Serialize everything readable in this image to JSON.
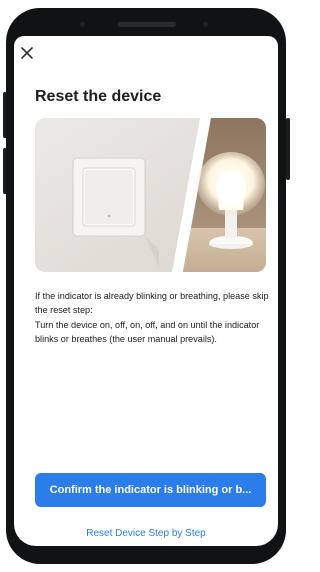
{
  "header": {
    "close_icon": "close-icon",
    "title": "Reset the device"
  },
  "hero": {
    "illustration": "switch-and-bulb-illustration"
  },
  "instructions": {
    "line1": "If the indicator is already blinking or breathing, please skip the reset step:",
    "line2": "Turn the device on, off, on, off, and on until the indicator blinks or breathes (the user manual prevails)."
  },
  "actions": {
    "confirm_label": "Confirm the indicator is blinking or b...",
    "step_by_step_label": "Reset Device Step by Step"
  },
  "colors": {
    "accent": "#2b7de9",
    "phone_frame": "#111214",
    "text": "#222222"
  }
}
